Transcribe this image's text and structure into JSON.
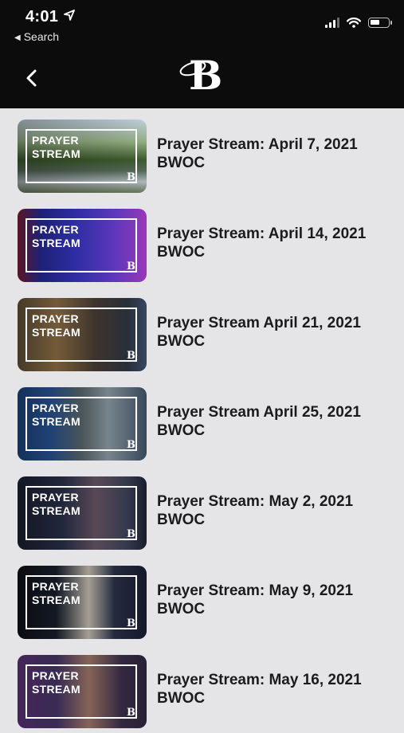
{
  "status_bar": {
    "time": "4:01",
    "back_app": "Search"
  },
  "nav": {
    "logo_text": "B"
  },
  "thumb_title": [
    "PRAYER",
    "STREAM"
  ],
  "thumb_mark": "B",
  "items": [
    {
      "line1": "Prayer Stream: April 7, 2021",
      "line2": "BWOC"
    },
    {
      "line1": "Prayer Stream: April 14, 2021",
      "line2": "BWOC"
    },
    {
      "line1": "Prayer Stream April 21, 2021",
      "line2": "BWOC"
    },
    {
      "line1": "Prayer Stream April 25, 2021",
      "line2": "BWOC"
    },
    {
      "line1": "Prayer Stream: May 2, 2021",
      "line2": "BWOC"
    },
    {
      "line1": "Prayer Stream: May 9, 2021",
      "line2": "BWOC"
    },
    {
      "line1": "Prayer Stream: May 16, 2021",
      "line2": "BWOC"
    }
  ]
}
